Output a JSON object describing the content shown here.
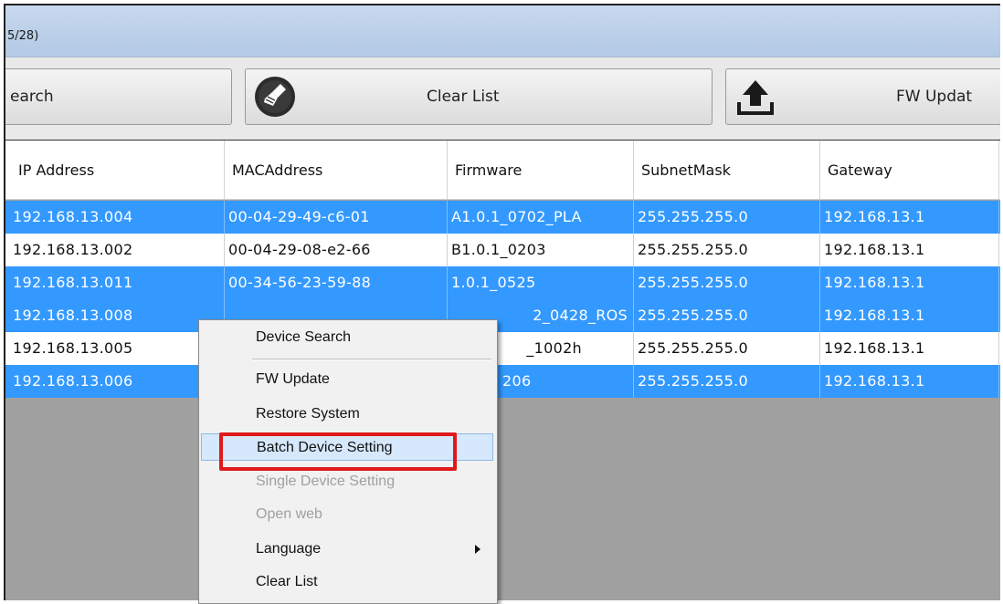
{
  "window": {
    "title": "5/28)"
  },
  "toolbar": {
    "search_label": "earch",
    "clear_label": "Clear List",
    "fw_label": "FW Updat"
  },
  "table": {
    "columns": [
      "IP Address",
      "MACAddress",
      "Firmware",
      "SubnetMask",
      "Gateway"
    ],
    "rows": [
      {
        "ip": "192.168.13.004",
        "mac": "00-04-29-49-c6-01",
        "fw": "A1.0.1_0702_PLA",
        "mask": "255.255.255.0",
        "gw": "192.168.13.1",
        "selected": true
      },
      {
        "ip": "192.168.13.002",
        "mac": "00-04-29-08-e2-66",
        "fw": "B1.0.1_0203",
        "mask": "255.255.255.0",
        "gw": "192.168.13.1",
        "selected": false
      },
      {
        "ip": "192.168.13.011",
        "mac": "00-34-56-23-59-88",
        "fw": "1.0.1_0525",
        "mask": "255.255.255.0",
        "gw": "192.168.13.1",
        "selected": true
      },
      {
        "ip": "192.168.13.008",
        "mac": "",
        "fw": "2_0428_ROS",
        "mask": "255.255.255.0",
        "gw": "192.168.13.1",
        "selected": true
      },
      {
        "ip": "192.168.13.005",
        "mac": "",
        "fw": "_1002h",
        "mask": "255.255.255.0",
        "gw": "192.168.13.1",
        "selected": false
      },
      {
        "ip": "192.168.13.006",
        "mac": "",
        "fw": "206",
        "mask": "255.255.255.0",
        "gw": "192.168.13.1",
        "selected": true
      }
    ]
  },
  "context_menu": {
    "items": [
      {
        "label": "Device Search",
        "enabled": true
      },
      {
        "label": "FW Update",
        "enabled": true
      },
      {
        "label": "Restore System",
        "enabled": true
      },
      {
        "label": "Batch Device Setting",
        "enabled": true,
        "highlighted": true
      },
      {
        "label": "Single Device Setting",
        "enabled": false
      },
      {
        "label": "Open web",
        "enabled": false
      },
      {
        "label": "Language",
        "enabled": true,
        "submenu": true
      },
      {
        "label": "Clear List",
        "enabled": true
      }
    ]
  },
  "colors": {
    "selection": "#3399ff",
    "annotation": "#e0191a",
    "menu_highlight": "#d6e8fb"
  }
}
